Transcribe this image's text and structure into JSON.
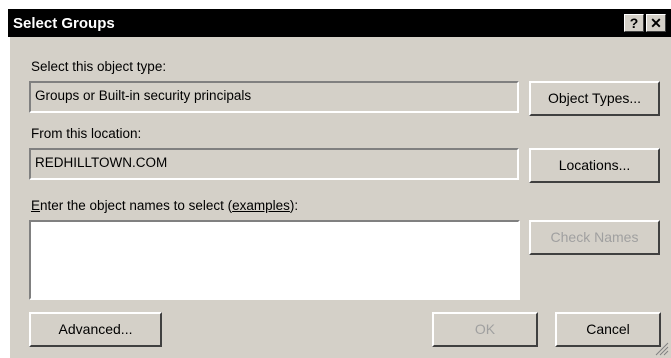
{
  "window": {
    "title": "Select Groups",
    "help_glyph": "?",
    "close_glyph": "✕"
  },
  "object_type": {
    "label": "Select this object type:",
    "value": "Groups or Built-in security principals",
    "button": "Object Types..."
  },
  "location": {
    "label": "From this location:",
    "value": "REDHILLTOWN.COM",
    "button": "Locations..."
  },
  "names": {
    "label_prefix": "E",
    "label_middle": "nter the object names to select (",
    "label_link": "examples",
    "label_suffix": "):",
    "value": "",
    "check_names_button": "Check Names"
  },
  "footer": {
    "advanced_button": "Advanced...",
    "ok_button": "OK",
    "cancel_button": "Cancel"
  },
  "colors": {
    "dialog_bg": "#d4d0c8",
    "title_bg": "#000000",
    "disabled_text": "#a0a0a0"
  }
}
